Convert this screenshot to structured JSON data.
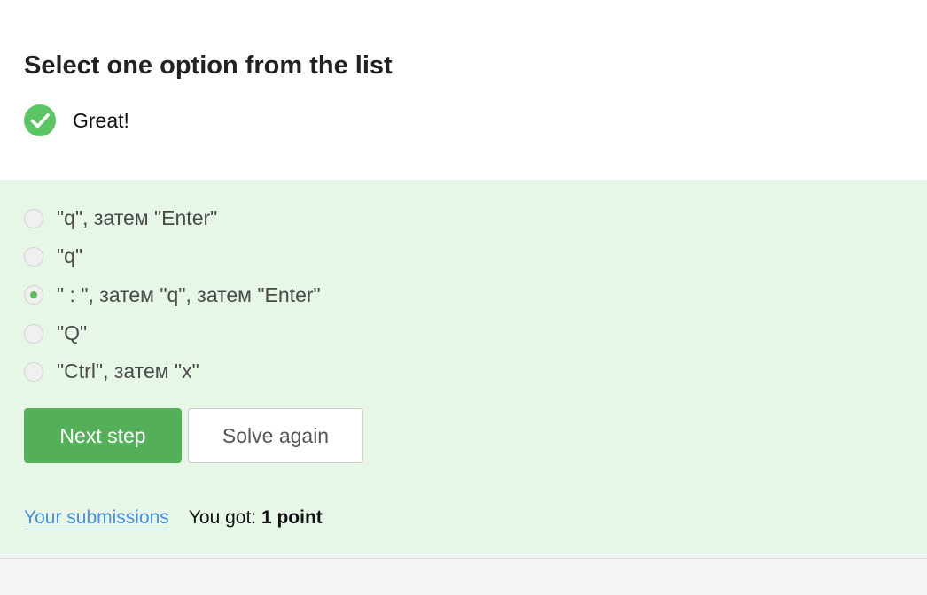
{
  "question": {
    "title": "Select one option from the list",
    "status_text": "Great!",
    "status_icon": "check-circle-icon",
    "status_color": "#5bc464"
  },
  "options": [
    {
      "label": "\"q\", затем \"Enter\"",
      "selected": false
    },
    {
      "label": "\"q\"",
      "selected": false
    },
    {
      "label": "\" : \", затем \"q\", затем \"Enter\"",
      "selected": true
    },
    {
      "label": "\"Q\"",
      "selected": false
    },
    {
      "label": "\"Ctrl\", затем \"x\"",
      "selected": false
    }
  ],
  "actions": {
    "next_label": "Next step",
    "again_label": "Solve again"
  },
  "footer": {
    "submissions_label": "Your submissions",
    "score_prefix": "You got: ",
    "score_value": "1 point"
  },
  "colors": {
    "correct_background": "#e6f6e7",
    "primary_button": "#53b058",
    "link": "#4a8fd8"
  }
}
